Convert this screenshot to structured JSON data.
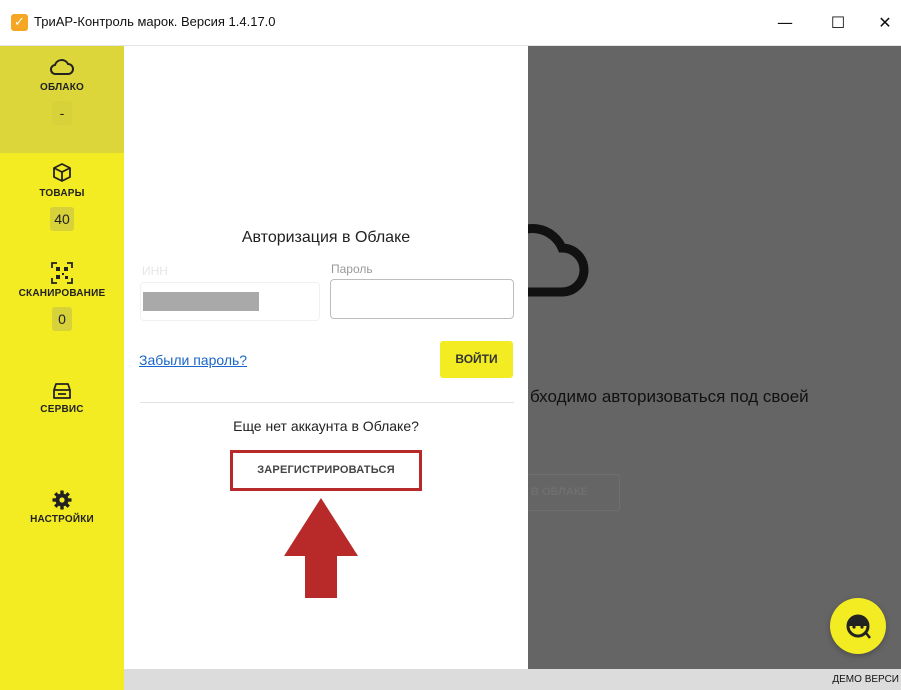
{
  "window": {
    "title": "ТриАР-Контроль марок. Версия 1.4.17.0",
    "minimize_glyph": "—",
    "maximize_glyph": "☐",
    "close_glyph": "✕"
  },
  "sidebar": {
    "items": [
      {
        "label": "ОБЛАКО",
        "badge": "-",
        "icon": "cloud-icon"
      },
      {
        "label": "ТОВАРЫ",
        "badge": "40",
        "icon": "box-icon"
      },
      {
        "label": "СКАНИРОВАНИЕ",
        "badge": "0",
        "icon": "qr-code-icon"
      },
      {
        "label": "СЕРВИС",
        "icon": "cash-register-icon"
      },
      {
        "label": "НАСТРОЙКИ",
        "icon": "gear-icon"
      }
    ]
  },
  "login": {
    "title": "Авторизация в Облаке",
    "inn_label": "ИНН",
    "password_label": "Пароль",
    "password_value": "",
    "forgot_link": "Забыли пароль?",
    "login_button": "ВОЙТИ",
    "no_account_text": "Еще нет аккаунта в Облаке?",
    "register_button": "ЗАРЕГИСТРИРОВАТЬСЯ"
  },
  "background": {
    "partial_text": "бходимо авторизоваться под своей",
    "partial_button": "В ОБЛАКЕ"
  },
  "status": {
    "text": "ДЕМО ВЕРСИ"
  },
  "colors": {
    "sidebar": "#f3ec22",
    "sidebar_active": "#dcd63a",
    "overlay": "#656565",
    "highlight_red": "#b82a2a",
    "link": "#1a66c9"
  }
}
